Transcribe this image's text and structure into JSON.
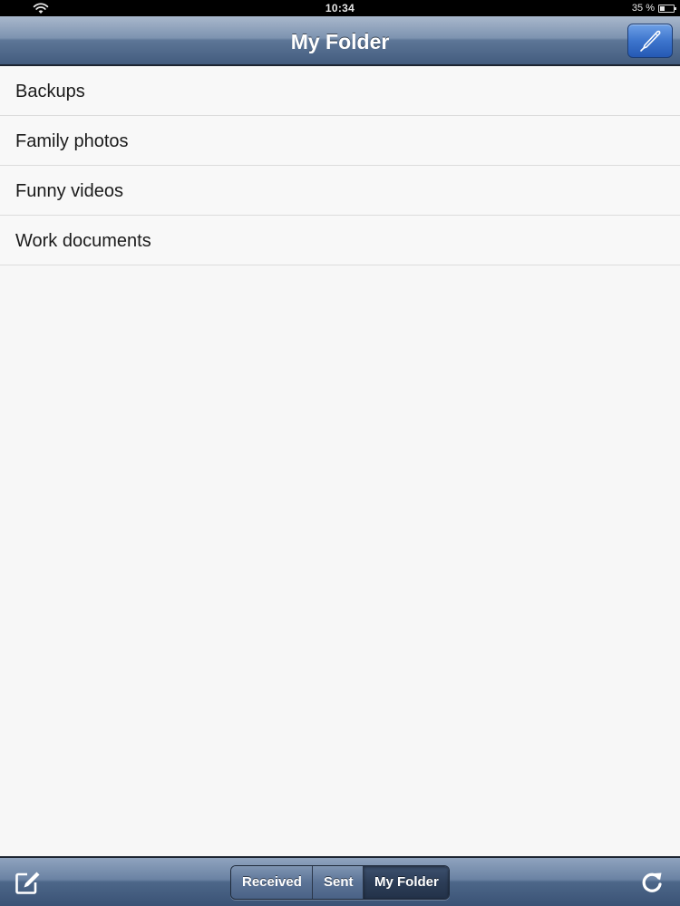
{
  "status_bar": {
    "time": "10:34",
    "battery_percent": "35 %",
    "battery_level": 0.35,
    "wifi_icon": "wifi-icon"
  },
  "nav": {
    "title": "My Folder",
    "action_icon": "pen-icon",
    "accent_color": "#3d75cd"
  },
  "folders": [
    {
      "label": "Backups"
    },
    {
      "label": "Family photos"
    },
    {
      "label": "Funny videos"
    },
    {
      "label": "Work documents"
    }
  ],
  "toolbar": {
    "compose_icon": "compose-icon",
    "refresh_icon": "refresh-icon",
    "segments": [
      {
        "label": "Received",
        "selected": false
      },
      {
        "label": "Sent",
        "selected": false
      },
      {
        "label": "My Folder",
        "selected": true
      }
    ]
  }
}
